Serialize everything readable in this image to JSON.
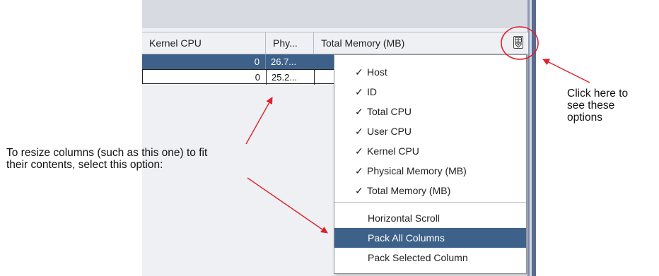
{
  "table": {
    "columns": [
      "Kernel CPU",
      "Phy...",
      "Total Memory (MB)"
    ],
    "rows": [
      {
        "kernel_cpu": "0",
        "phy": "26.7...",
        "selected": true
      },
      {
        "kernel_cpu": "0",
        "phy": "25.2...",
        "selected": false
      }
    ],
    "column_menu_icon": "column-control-icon"
  },
  "column_menu": {
    "checked_items": [
      {
        "check": "✓",
        "label": "Host"
      },
      {
        "check": "✓",
        "label": "ID"
      },
      {
        "check": "✓",
        "label": "Total CPU"
      },
      {
        "check": "✓",
        "label": "User CPU"
      },
      {
        "check": "✓",
        "label": "Kernel CPU"
      },
      {
        "check": "✓",
        "label": "Physical Memory (MB)"
      },
      {
        "check": "✓",
        "label": "Total Memory (MB)"
      }
    ],
    "actions": [
      {
        "label": "Horizontal Scroll"
      },
      {
        "label": "Pack All Columns",
        "highlighted": true
      },
      {
        "label": "Pack Selected Column"
      }
    ]
  },
  "annotations": {
    "resize_note": "To resize columns (such as this one) to fit\ntheir contents, select this option:",
    "click_note": "Click here to\nsee these\noptions"
  },
  "colors": {
    "selection": "#3d6189",
    "arrow": "#e0202a",
    "header_bg": "#eef0f3"
  }
}
